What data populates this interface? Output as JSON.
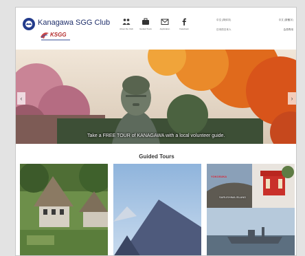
{
  "header": {
    "club_name": "Kanagawa SGG Club",
    "sub_logo": "KSGG",
    "nav": [
      {
        "label": "About the Club",
        "icon": "people-icon"
      },
      {
        "label": "Guided Tours",
        "icon": "briefcase-icon"
      },
      {
        "label": "Application",
        "icon": "mail-icon"
      },
      {
        "label": "Facebook",
        "icon": "facebook-icon"
      }
    ],
    "lang_links": [
      [
        "中文 (简体字)",
        "中文 (繁體字)"
      ],
      [
        "日本的日本人",
        "会員専用"
      ]
    ]
  },
  "hero": {
    "caption": "Take a FREE TOUR of KANAGAWA with a local volunteer guide.",
    "prev": "‹",
    "next": "›"
  },
  "section": {
    "title": "Guided Tours"
  },
  "tours": [
    {
      "name": "Shirakawa-go style thatched houses"
    },
    {
      "name": "Mount Fuji"
    },
    {
      "label_a": "YOKOSUKA",
      "label_b": "SARUSHIMA ISLAND"
    }
  ],
  "colors": {
    "brand_blue": "#243c8c",
    "logo_red": "#b22a2a"
  }
}
